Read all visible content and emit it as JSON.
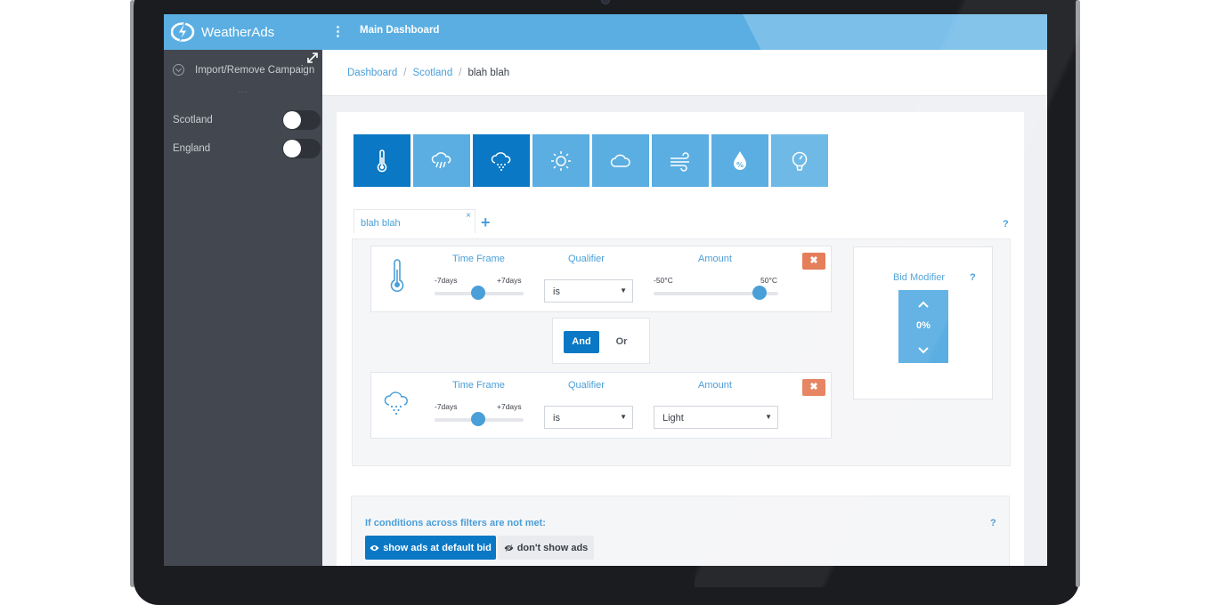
{
  "app": {
    "brand": "WeatherAds",
    "page_title": "Main Dashboard",
    "colors": {
      "primary": "#5aaee2",
      "active": "#0a78c4",
      "sidebar": "#43474f",
      "danger": "#e57e5a"
    }
  },
  "sidebar": {
    "import_label": "Import/Remove Campaign",
    "more": "...",
    "items": [
      {
        "label": "Scotland",
        "on": false
      },
      {
        "label": "England",
        "on": false
      }
    ]
  },
  "breadcrumb": {
    "items": [
      "Dashboard",
      "Scotland",
      "blah blah"
    ],
    "sep": "/"
  },
  "weather_tabs": [
    {
      "icon": "thermometer-icon",
      "active": true
    },
    {
      "icon": "rain-icon",
      "active": false
    },
    {
      "icon": "snow-icon",
      "active": true
    },
    {
      "icon": "sun-icon",
      "active": false
    },
    {
      "icon": "cloud-icon",
      "active": false
    },
    {
      "icon": "wind-icon",
      "active": false
    },
    {
      "icon": "humidity-icon",
      "active": false
    },
    {
      "icon": "pressure-gauge-icon",
      "active": false
    }
  ],
  "rule": {
    "tab_label": "blah blah",
    "close": "×",
    "add": "+",
    "help": "?"
  },
  "conditions": [
    {
      "icon": "thermometer-icon",
      "time_frame": {
        "header": "Time Frame",
        "min_label": "-7days",
        "max_label": "+7days",
        "value_fraction": 0.5
      },
      "qualifier": {
        "header": "Qualifier",
        "value": "is"
      },
      "amount": {
        "header": "Amount",
        "type": "slider",
        "min_label": "-50°C",
        "max_label": "50°C",
        "value_fraction": 0.85
      },
      "delete": "✖"
    },
    {
      "icon": "snow-icon",
      "time_frame": {
        "header": "Time Frame",
        "min_label": "-7days",
        "max_label": "+7days",
        "value_fraction": 0.5
      },
      "qualifier": {
        "header": "Qualifier",
        "value": "is"
      },
      "amount": {
        "header": "Amount",
        "type": "select",
        "value": "Light"
      },
      "delete": "✖"
    }
  ],
  "logic": {
    "and_label": "And",
    "or_label": "Or",
    "selected": "And"
  },
  "bid_modifier": {
    "label": "Bid Modifier",
    "help": "?",
    "value": "0%",
    "up": "⌃",
    "down": "⌄"
  },
  "fallback": {
    "label": "If conditions across filters are not met:",
    "help": "?",
    "show_label": "show ads at default bid",
    "hide_label": "don't show ads",
    "selected": "show"
  }
}
